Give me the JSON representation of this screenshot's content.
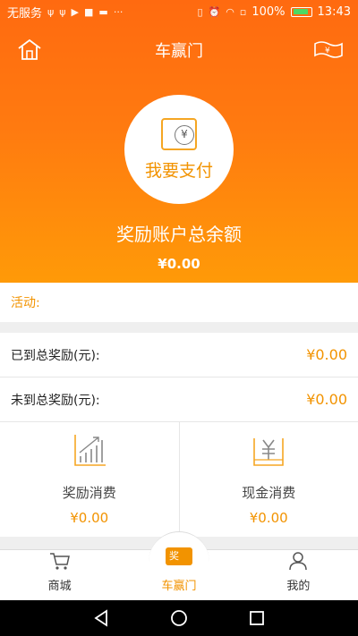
{
  "status_bar": {
    "carrier": "无服务",
    "battery": "100%",
    "time": "13:43"
  },
  "header": {
    "title": "车赢门"
  },
  "pay": {
    "label": "我要支付"
  },
  "balance": {
    "title": "奖励账户总余额",
    "value": "¥0.00"
  },
  "activity": {
    "label": "活动:"
  },
  "rewards": {
    "arrived_label": "已到总奖励(元):",
    "arrived_value": "¥0.00",
    "pending_label": "未到总奖励(元):",
    "pending_value": "¥0.00"
  },
  "tiles": [
    {
      "label": "奖励消费",
      "value": "¥0.00",
      "icon": "growth-chart-icon"
    },
    {
      "label": "现金消费",
      "value": "¥0.00",
      "icon": "cash-tray-icon"
    }
  ],
  "bottom_nav": {
    "items": [
      {
        "label": "商城",
        "icon": "cart-icon"
      },
      {
        "label": "车赢门",
        "icon": "reward-card-icon",
        "active": true
      },
      {
        "label": "我的",
        "icon": "user-icon"
      }
    ],
    "center_badge": "奖"
  },
  "colors": {
    "accent": "#f29300",
    "hero_top": "#ff6a10",
    "hero_bottom": "#ff9a08"
  }
}
